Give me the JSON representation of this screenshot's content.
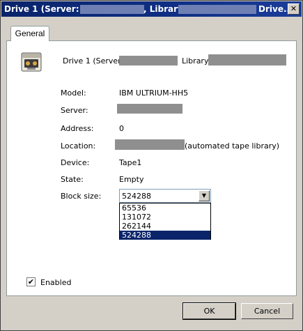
{
  "window": {
    "title_prefix": "Drive 1 (Server:",
    "title_library": ", Library:",
    "title_suffix": "Drive...",
    "close_glyph": "✕"
  },
  "tabs": [
    {
      "label": "General"
    }
  ],
  "header": {
    "drive_label": "Drive 1 (Server:",
    "library_label": "Library:"
  },
  "properties": {
    "model": {
      "label": "Model:",
      "value": "IBM ULTRIUM-HH5"
    },
    "server": {
      "label": "Server:"
    },
    "address": {
      "label": "Address:",
      "value": "0"
    },
    "location": {
      "label": "Location:",
      "suffix": "(automated tape library)"
    },
    "device": {
      "label": "Device:",
      "value": "Tape1"
    },
    "state": {
      "label": "State:",
      "value": "Empty"
    },
    "block_size": {
      "label": "Block size:",
      "selected": "524288",
      "options": [
        "65536",
        "131072",
        "262144",
        "524288"
      ]
    }
  },
  "enabled": {
    "label": "Enabled",
    "checked": true,
    "glyph": "✔"
  },
  "buttons": {
    "ok": "OK",
    "cancel": "Cancel"
  },
  "icons": {
    "drive": "tape-drive-icon",
    "dropdown_arrow": "▼"
  }
}
